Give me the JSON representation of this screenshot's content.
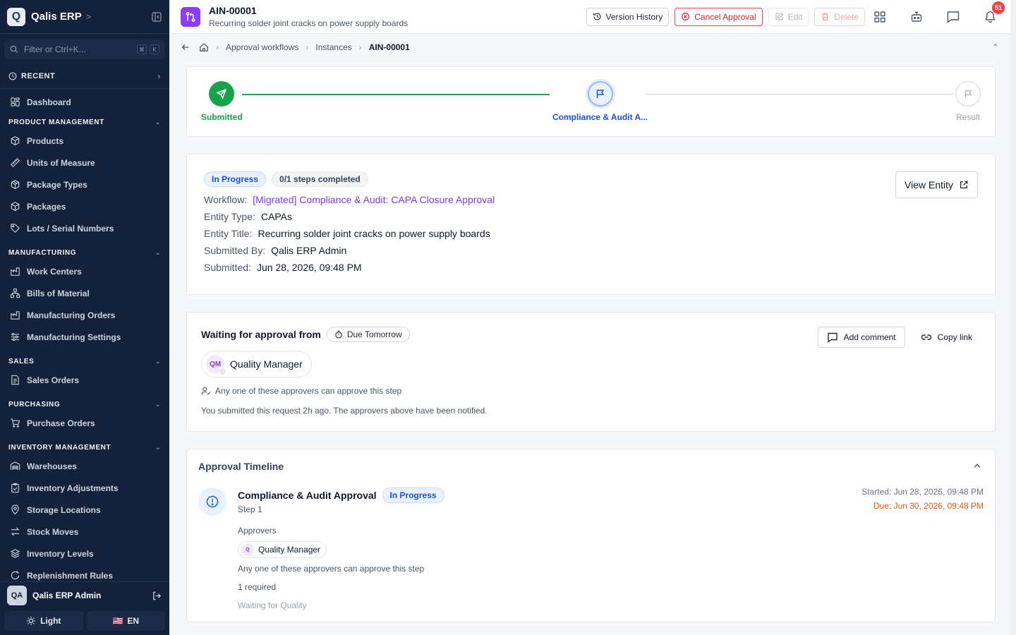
{
  "sidebar": {
    "brand": "Qalis ERP",
    "logo_letter": "Q",
    "filter_placeholder": "Filter or Ctrl+K...",
    "kbd": [
      "⌘",
      "K"
    ],
    "recent_label": "RECENT",
    "dashboard": "Dashboard",
    "sections": {
      "product": {
        "label": "PRODUCT MANAGEMENT",
        "items": [
          "Products",
          "Units of Measure",
          "Package Types",
          "Packages",
          "Lots / Serial Numbers"
        ]
      },
      "manufacturing": {
        "label": "MANUFACTURING",
        "items": [
          "Work Centers",
          "Bills of Material",
          "Manufacturing Orders",
          "Manufacturing Settings"
        ]
      },
      "sales": {
        "label": "SALES",
        "items": [
          "Sales Orders"
        ]
      },
      "purchasing": {
        "label": "PURCHASING",
        "items": [
          "Purchase Orders"
        ]
      },
      "inventory": {
        "label": "INVENTORY MANAGEMENT",
        "items": [
          "Warehouses",
          "Inventory Adjustments",
          "Storage Locations",
          "Stock Moves",
          "Inventory Levels",
          "Replenishment Rules"
        ]
      }
    },
    "user": {
      "initials": "QA",
      "name": "Qalis ERP Admin"
    },
    "theme_label": "Light",
    "lang_label": "EN",
    "lang_flag": "🇺🇸"
  },
  "header": {
    "title": "AIN-00001",
    "subtitle": "Recurring solder joint cracks on power supply boards",
    "version_history": "Version History",
    "cancel_approval": "Cancel Approval",
    "edit": "Edit",
    "delete": "Delete",
    "notification_count": "51"
  },
  "breadcrumb": {
    "items": [
      "Approval workflows",
      "Instances"
    ],
    "current": "AIN-00001"
  },
  "stepper": {
    "steps": [
      {
        "label": "Submitted",
        "state": "done"
      },
      {
        "label": "Compliance & Audit A...",
        "state": "current"
      },
      {
        "label": "Result",
        "state": "pending"
      }
    ]
  },
  "info": {
    "status": "In Progress",
    "steps_completed": "0/1 steps completed",
    "workflow_label": "Workflow:",
    "workflow_value": "[Migrated] Compliance & Audit: CAPA Closure Approval",
    "entity_type_label": "Entity Type:",
    "entity_type_value": "CAPAs",
    "entity_title_label": "Entity Title:",
    "entity_title_value": "Recurring solder joint cracks on power supply boards",
    "submitted_by_label": "Submitted By:",
    "submitted_by_value": "Qalis ERP Admin",
    "submitted_label": "Submitted:",
    "submitted_value": "Jun 28, 2026, 09:48 PM",
    "view_entity": "View Entity"
  },
  "waiting": {
    "title": "Waiting for approval from",
    "due": "Due Tomorrow",
    "add_comment": "Add comment",
    "copy_link": "Copy link",
    "approver_initials": "QM",
    "approver_name": "Quality Manager",
    "any_one": "Any one of these approvers can approve this step",
    "note": "You submitted this request 2h ago. The approvers above have been notified."
  },
  "timeline": {
    "title": "Approval Timeline",
    "step_title": "Compliance & Audit Approval",
    "status": "In Progress",
    "step_sub": "Step 1",
    "approvers_label": "Approvers",
    "approver_initials": "Q",
    "approver_name": "Quality Manager",
    "any_one": "Any one of these approvers can approve this step",
    "required": "1 required",
    "waiting_for": "Waiting for Quality",
    "started": "Started: Jun 28, 2026, 09:48 PM",
    "due": "Due: Jun 30, 2026, 09:48 PM"
  },
  "colors": {
    "sidebar_bg": "#14213a",
    "accent_purple": "#8b3dff",
    "success_green": "#16a34a",
    "current_blue": "#1d4ed8",
    "danger_red": "#dc2626",
    "due_orange": "#ea580c"
  }
}
